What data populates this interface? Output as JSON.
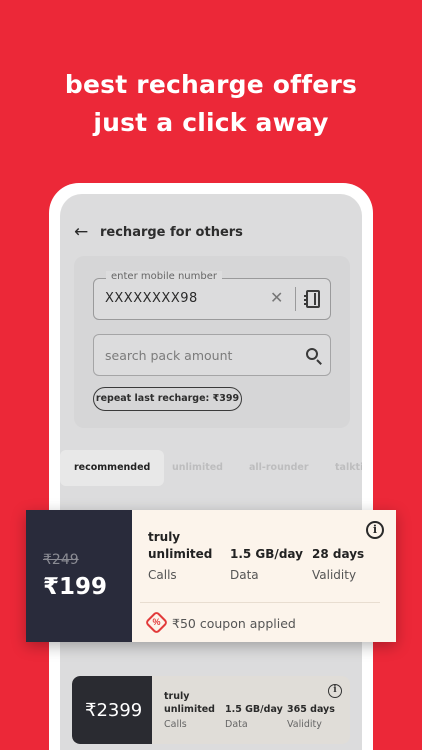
{
  "headline": {
    "line1": "best recharge offers",
    "line2": "just a click away"
  },
  "topbar": {
    "back_icon": "arrow-left-icon",
    "title": "recharge for others"
  },
  "mobile_field": {
    "label": "enter mobile number",
    "value": "XXXXXXXX98",
    "clear_icon": "close-icon",
    "contacts_icon": "contacts-book-icon"
  },
  "search_field": {
    "placeholder": "search pack amount",
    "icon": "search-icon"
  },
  "repeat_chip": {
    "label": "repeat last recharge: ₹399"
  },
  "tabs": [
    {
      "label": "recommended",
      "active": true
    },
    {
      "label": "unlimited",
      "active": false
    },
    {
      "label": "all-rounder",
      "active": false
    },
    {
      "label": "talkti",
      "active": false
    }
  ],
  "offer_card": {
    "old_price": "₹249",
    "price": "₹199",
    "benefits": [
      {
        "value": "truly unlimited",
        "label": "Calls"
      },
      {
        "value": "1.5 GB/day",
        "label": "Data"
      },
      {
        "value": "28 days",
        "label": "Validity"
      }
    ],
    "info_icon": "info-icon",
    "coupon_icon": "coupon-percent-icon",
    "coupon_text": "₹50 coupon applied"
  },
  "pack_card": {
    "price": "₹2399",
    "benefits": [
      {
        "value": "truly unlimited",
        "label": "Calls"
      },
      {
        "value": "1.5 GB/day",
        "label": "Data"
      },
      {
        "value": "365 days",
        "label": "Validity"
      }
    ],
    "info_icon": "info-icon"
  },
  "colors": {
    "background": "#EC2838",
    "price_box": "#292B3B",
    "card": "#FCF4EB",
    "coupon": "#E23A3A"
  }
}
